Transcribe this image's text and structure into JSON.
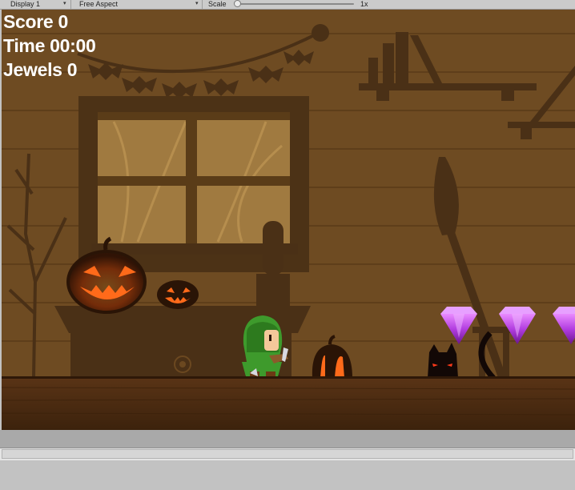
{
  "toolbar": {
    "display_label": "Display 1",
    "aspect_label": "Free Aspect",
    "scale_label": "Scale",
    "scale_value": "1x",
    "scale_fraction": 0
  },
  "hud": {
    "score": "Score 0",
    "time": "Time 00:00",
    "jewels": "Jewels 0"
  },
  "scene": {
    "background_color": "#6b4820",
    "floor_color": "#4a2a10",
    "jewel_color": "#b23de0",
    "pumpkin_glow": "#ff6a1a"
  }
}
